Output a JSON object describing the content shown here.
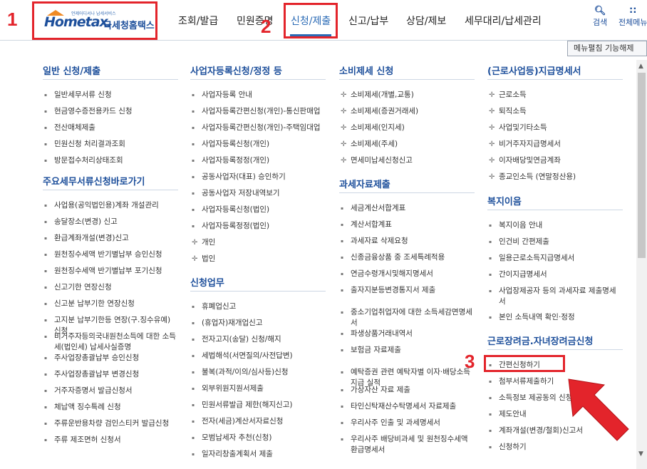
{
  "logo": {
    "small": "언제어디서나 납세서비스",
    "home": "Hometax.",
    "kr": "국세청홈택스"
  },
  "nav": [
    "조회/발급",
    "민원증명",
    "신청/제출",
    "신고/납부",
    "상담/제보",
    "세무대리/납세관리"
  ],
  "tools": {
    "search": "검색",
    "all_menu": "전체메뉴"
  },
  "menu_fold_button": "메뉴펼침 기능해제",
  "annotations": [
    "1",
    "2",
    "3"
  ],
  "colors": {
    "accent": "#1d4f9b",
    "highlight": "#e3242b"
  },
  "columns": [
    {
      "sections": [
        {
          "title": "일반 신청/제출",
          "items": [
            "일반세무서류 신청",
            "현금영수증전용카드 신청",
            "전산매체제출",
            "민원신청 처리결과조회",
            "방문접수처리상태조회"
          ]
        },
        {
          "title": "주요세무서류신청바로가기",
          "items": [
            "사업용(공익법인용)계좌 개설관리",
            "송달장소(변경) 신고",
            "환급계좌개설(변경)신고",
            "원천징수세액 반기별납부 승인신청",
            "원천징수세액 반기별납부 포기신청",
            "신고기한 연장신청",
            "신고분 납부기한 연장신청",
            "고지분 납부기한등 연장(구.징수유예) 신청",
            "비거주자등의국내원천소득에 대한 소득세(법인세) 납세사실증명",
            "주사업장총괄납부 승인신청",
            "주사업장총괄납부 변경신청",
            "거주자증명서 발급신청서",
            "체납액 징수특례 신청",
            "주류운반용차량 검인스티커 발급신청",
            "주류 제조면허 신청서"
          ]
        }
      ]
    },
    {
      "sections": [
        {
          "title": "사업자등록신청/정정 등",
          "items": [
            "사업자등록 안내",
            "사업자등록간편신청(개인)-통신판매업",
            "사업자등록간편신청(개인)-주택임대업",
            "사업자등록신청(개인)",
            "사업자등록정정(개인)",
            "공동사업자(대표) 승인하기",
            "공동사업자 저장내역보기",
            "사업자등록신청(법인)",
            "사업자등록정정(법인)",
            "개인",
            "법인"
          ]
        },
        {
          "title": "신청업무",
          "items": [
            "휴폐업신고",
            "(휴업자)재개업신고",
            "전자고지(송달) 신청/해지",
            "세법해석(서면질의/사전답변)",
            "불복(과적/이의/심사등)신청",
            "외부위원지원서제출",
            "민원서류발급 제한(해지신고)",
            "전자(세금)계산서자료신청",
            "모범납세자 추천(신청)",
            "일자리창출계획서 제출"
          ]
        }
      ]
    },
    {
      "sections": [
        {
          "title": "소비제세 신청",
          "items": [
            "소비제세(개별,교통)",
            "소비제세(증권거래세)",
            "소비제세(인지세)",
            "소비제세(주세)",
            "면세미납세신청신고"
          ]
        },
        {
          "title": "과세자료제출",
          "items": [
            "세금계산서합계표",
            "계산서합계표",
            "과세자료 삭제요청",
            "신종금융상품 중 조세특례적용",
            "연금수령개시및해지명세서",
            "출자지분등변경통지서 제출",
            "중소기업취업자에 대한 소득세감면명세서",
            "파생상품거래내역서",
            "보험금 자료제출",
            "예탁증권 관련 예탁자별 이자·배당소득 지급 실적",
            "가상자산 자료 제출",
            "타인신탁재산수탁명세서 자료제출",
            "우리사주 인출 및 과세명세서",
            "우리사주 배당비과세 및 원천징수세액 환급명세서"
          ]
        }
      ]
    },
    {
      "sections": [
        {
          "title": "(근로사업등)지급명세서",
          "items": [
            "근로소득",
            "퇴직소득",
            "사업및기타소득",
            "비거주자지급명세서",
            "이자배당및연금계좌",
            "종교인소득 (연말정산용)"
          ]
        },
        {
          "title": "복지이음",
          "items": [
            "복지이음 안내",
            "인건비 간편제출",
            "일용근로소득지급명세서",
            "간이지급명세서",
            "사업장제공자 등의 과세자료 제출명세서",
            "본인 소득내역 확인·정정"
          ]
        },
        {
          "title": "근로장려금.자녀장려금신청",
          "items": [
            "간편신청하기",
            "첨부서류제출하기",
            "소득정보 제공동의 신청",
            "제도안내",
            "계좌개설(변경/철회)신고서",
            "신청하기"
          ]
        }
      ]
    }
  ]
}
